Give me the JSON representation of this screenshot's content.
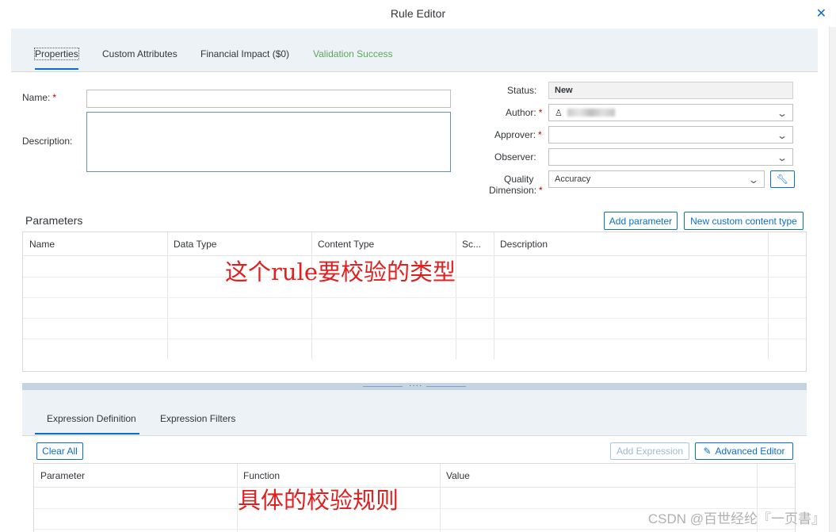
{
  "window": {
    "title": "Rule Editor"
  },
  "tabs": [
    {
      "label": "Properties"
    },
    {
      "label": "Custom Attributes"
    },
    {
      "label": "Financial Impact ($0)"
    },
    {
      "label": "Validation Success"
    }
  ],
  "form": {
    "name_label": "Name:",
    "name_value": "",
    "description_label": "Description:",
    "description_value": "",
    "required_mark": "*"
  },
  "side_fields": {
    "status_label": "Status:",
    "status_value": "New",
    "author_label": "Author:",
    "approver_label": "Approver:",
    "approver_value": "",
    "observer_label": "Observer:",
    "observer_value": "",
    "quality_label_line1": "Quality",
    "quality_label_line2": "Dimension:",
    "quality_value": "Accuracy"
  },
  "parameters": {
    "title": "Parameters",
    "add_button": "Add parameter",
    "custom_button": "New custom content type",
    "columns": [
      "Name",
      "Data Type",
      "Content Type",
      "Sc...",
      "Description"
    ]
  },
  "expression": {
    "tabs": [
      {
        "label": "Expression Definition"
      },
      {
        "label": "Expression Filters"
      }
    ],
    "clear_all": "Clear All",
    "add_expression": "Add Expression",
    "advanced_editor": "Advanced Editor",
    "columns": [
      "Parameter",
      "Function",
      "Value"
    ]
  },
  "annotations": {
    "params_note": "这个rule要校验的类型",
    "expression_note": "具体的校验规则"
  },
  "watermark": "CSDN @百世经纶『一页書』",
  "colors": {
    "accent": "#0a6ed1",
    "success": "#5ca65c",
    "required": "#bb0000",
    "annotation": "#e02020"
  }
}
